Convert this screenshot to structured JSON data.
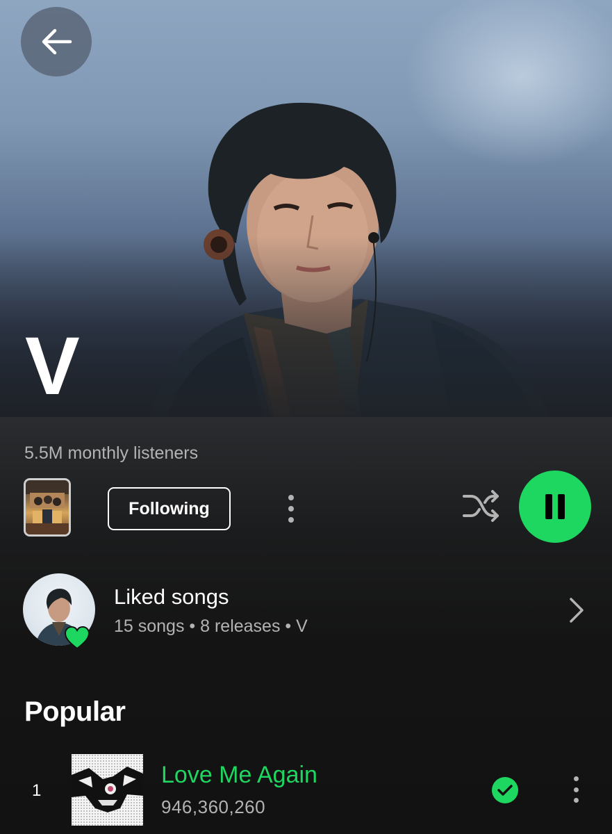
{
  "artist": {
    "name": "V",
    "monthly_listeners": "5.5M monthly listeners"
  },
  "header": {
    "back_icon": "arrow-left-icon"
  },
  "actions": {
    "follow_label": "Following",
    "more_icon": "more-vertical-icon",
    "shuffle_icon": "shuffle-icon",
    "play_state_icon": "pause-icon",
    "accent_color": "#1ed760"
  },
  "liked_songs": {
    "title": "Liked songs",
    "subtitle": "15 songs • 8 releases • V",
    "badge_icon": "heart-icon",
    "chevron_icon": "chevron-right-icon"
  },
  "popular": {
    "section_title": "Popular",
    "tracks": [
      {
        "index": "1",
        "title": "Love Me Again",
        "plays": "946,360,260",
        "downloaded_icon": "check-circle-icon",
        "more_icon": "more-vertical-icon"
      }
    ]
  },
  "colors": {
    "background": "#121212",
    "secondary_text": "#b3b3b3",
    "green": "#1ed760"
  }
}
